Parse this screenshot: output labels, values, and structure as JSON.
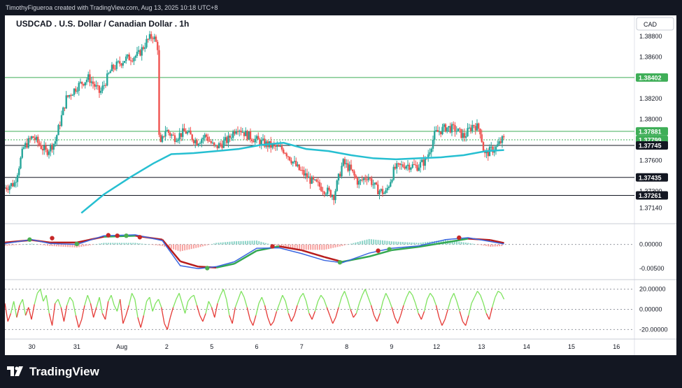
{
  "header": {
    "attribution": "TimothyFigueroa created with TradingView.com, Aug 13, 2025 10:18 UTC+8",
    "brand": "TradingView"
  },
  "colors": {
    "up": "#26a69a",
    "down": "#ef5350",
    "ma_line": "#26bfd1",
    "macd_line": "#3a66e0",
    "signal_line_up": "#34a853",
    "signal_line_down": "#b71c1c",
    "rsi_up": "#7ee35e",
    "rsi_down": "#e53935",
    "level_green": "#3fae58",
    "level_black": "#131722",
    "topbar_bg": "#131722"
  },
  "chart_data": {
    "type": "candlestick",
    "title": "USDCAD . U.S. Dollar / Canadian Dollar . 1h",
    "currency_label": "CAD",
    "price_axis": {
      "range": [
        1.37,
        1.3895
      ],
      "ticks": [
        "1.38800",
        "1.38600",
        "1.38200",
        "1.38000",
        "1.37600",
        "1.37300",
        "1.37140"
      ]
    },
    "price_badges": [
      {
        "label": "1.38402",
        "value": 1.38402,
        "style": "green"
      },
      {
        "label": "1.37881",
        "value": 1.37881,
        "style": "green"
      },
      {
        "label": "1.37799",
        "value": 1.37799,
        "style": "green"
      },
      {
        "label": "1.37745",
        "value": 1.37745,
        "style": "black"
      },
      {
        "label": "1.37435",
        "value": 1.37435,
        "style": "black"
      },
      {
        "label": "1.37261",
        "value": 1.37261,
        "style": "black"
      }
    ],
    "x_axis": {
      "range": [
        0,
        14
      ],
      "labels": [
        {
          "t": 0.6,
          "label": "30"
        },
        {
          "t": 1.6,
          "label": "31"
        },
        {
          "t": 2.6,
          "label": "Aug"
        },
        {
          "t": 3.6,
          "label": "2"
        },
        {
          "t": 4.6,
          "label": "5"
        },
        {
          "t": 5.6,
          "label": "6"
        },
        {
          "t": 6.6,
          "label": "7"
        },
        {
          "t": 7.6,
          "label": "8"
        },
        {
          "t": 8.6,
          "label": "9"
        },
        {
          "t": 9.6,
          "label": "12"
        },
        {
          "t": 10.6,
          "label": "13"
        },
        {
          "t": 11.6,
          "label": "14"
        },
        {
          "t": 12.6,
          "label": "15"
        },
        {
          "t": 13.6,
          "label": "16"
        }
      ]
    },
    "price_path": [
      [
        0.0,
        1.3733
      ],
      [
        0.25,
        1.3738
      ],
      [
        0.45,
        1.3772
      ],
      [
        0.65,
        1.3783
      ],
      [
        0.95,
        1.3768
      ],
      [
        1.15,
        1.3778
      ],
      [
        1.4,
        1.382
      ],
      [
        1.65,
        1.3832
      ],
      [
        1.9,
        1.384
      ],
      [
        2.15,
        1.3825
      ],
      [
        2.4,
        1.3848
      ],
      [
        2.7,
        1.3858
      ],
      [
        3.0,
        1.3862
      ],
      [
        3.2,
        1.3876
      ],
      [
        3.33,
        1.3881
      ],
      [
        3.43,
        1.387
      ],
      [
        3.47,
        1.377
      ],
      [
        3.6,
        1.379
      ],
      [
        3.8,
        1.3782
      ],
      [
        4.05,
        1.3788
      ],
      [
        4.3,
        1.3778
      ],
      [
        4.5,
        1.3784
      ],
      [
        4.7,
        1.3772
      ],
      [
        5.0,
        1.378
      ],
      [
        5.2,
        1.3793
      ],
      [
        5.4,
        1.3785
      ],
      [
        5.7,
        1.3778
      ],
      [
        5.95,
        1.3774
      ],
      [
        6.25,
        1.377
      ],
      [
        6.55,
        1.3752
      ],
      [
        6.85,
        1.374
      ],
      [
        7.1,
        1.3733
      ],
      [
        7.35,
        1.3726
      ],
      [
        7.55,
        1.3758
      ],
      [
        7.7,
        1.3752
      ],
      [
        7.9,
        1.3738
      ],
      [
        8.1,
        1.3745
      ],
      [
        8.3,
        1.3732
      ],
      [
        8.5,
        1.3728
      ],
      [
        8.7,
        1.3752
      ],
      [
        8.95,
        1.3756
      ],
      [
        9.2,
        1.3754
      ],
      [
        9.4,
        1.376
      ],
      [
        9.6,
        1.3786
      ],
      [
        9.85,
        1.3792
      ],
      [
        10.05,
        1.379
      ],
      [
        10.25,
        1.3783
      ],
      [
        10.45,
        1.3795
      ],
      [
        10.6,
        1.379
      ],
      [
        10.7,
        1.3765
      ],
      [
        10.85,
        1.377
      ],
      [
        10.95,
        1.3772
      ],
      [
        11.1,
        1.378
      ]
    ],
    "moving_average_path": [
      [
        1.7,
        1.3709
      ],
      [
        2.2,
        1.3727
      ],
      [
        2.8,
        1.3744
      ],
      [
        3.3,
        1.3757
      ],
      [
        3.7,
        1.3766
      ],
      [
        4.2,
        1.3767
      ],
      [
        4.7,
        1.3769
      ],
      [
        5.2,
        1.3771
      ],
      [
        5.7,
        1.3775
      ],
      [
        6.2,
        1.3777
      ],
      [
        6.7,
        1.3771
      ],
      [
        7.2,
        1.3769
      ],
      [
        7.7,
        1.3765
      ],
      [
        8.2,
        1.3762
      ],
      [
        8.7,
        1.3761
      ],
      [
        9.2,
        1.3762
      ],
      [
        9.7,
        1.3763
      ],
      [
        10.2,
        1.3765
      ],
      [
        10.7,
        1.3769
      ],
      [
        11.1,
        1.377
      ]
    ],
    "macd": {
      "range": [
        -0.007,
        0.004
      ],
      "ticks": [
        "0.00000",
        "-0.00500"
      ],
      "macd_path": [
        [
          0.0,
          0.0002
        ],
        [
          0.6,
          0.001
        ],
        [
          1.0,
          0.0002
        ],
        [
          1.6,
          0.0
        ],
        [
          2.2,
          0.0018
        ],
        [
          2.9,
          0.002
        ],
        [
          3.5,
          0.0008
        ],
        [
          3.9,
          -0.0044
        ],
        [
          4.3,
          -0.005
        ],
        [
          4.7,
          -0.0046
        ],
        [
          5.1,
          -0.0036
        ],
        [
          5.6,
          -0.0008
        ],
        [
          6.1,
          -0.0007
        ],
        [
          6.6,
          -0.0019
        ],
        [
          7.1,
          -0.0033
        ],
        [
          7.5,
          -0.0038
        ],
        [
          8.1,
          -0.0018
        ],
        [
          8.6,
          -0.0008
        ],
        [
          9.2,
          -0.0003
        ],
        [
          9.8,
          0.001
        ],
        [
          10.3,
          0.0014
        ],
        [
          10.8,
          0.0006
        ],
        [
          11.1,
          0.0001
        ]
      ],
      "signal_path": [
        [
          0.0,
          0.0004
        ],
        [
          0.6,
          0.0009
        ],
        [
          1.0,
          0.0004
        ],
        [
          1.6,
          0.0004
        ],
        [
          2.2,
          0.0016
        ],
        [
          2.9,
          0.0018
        ],
        [
          3.5,
          0.001
        ],
        [
          3.9,
          -0.0035
        ],
        [
          4.3,
          -0.0046
        ],
        [
          4.7,
          -0.0048
        ],
        [
          5.1,
          -0.004
        ],
        [
          5.6,
          -0.0013
        ],
        [
          6.1,
          -0.0004
        ],
        [
          6.6,
          -0.0012
        ],
        [
          7.1,
          -0.0026
        ],
        [
          7.5,
          -0.0036
        ],
        [
          8.1,
          -0.0025
        ],
        [
          8.6,
          -0.0012
        ],
        [
          9.2,
          -0.0005
        ],
        [
          9.8,
          0.0004
        ],
        [
          10.3,
          0.0012
        ],
        [
          10.8,
          0.0009
        ],
        [
          11.1,
          0.0003
        ]
      ],
      "cross_markers": [
        {
          "t": 0.55,
          "v": 0.001,
          "kind": "bull"
        },
        {
          "t": 1.05,
          "v": 0.0013,
          "kind": "bear"
        },
        {
          "t": 1.6,
          "v": 0.0001,
          "kind": "bull"
        },
        {
          "t": 2.3,
          "v": 0.0019,
          "kind": "bear"
        },
        {
          "t": 2.5,
          "v": 0.0018,
          "kind": "bear"
        },
        {
          "t": 2.7,
          "v": 0.0018,
          "kind": "bull"
        },
        {
          "t": 3.0,
          "v": 0.0015,
          "kind": "bear"
        },
        {
          "t": 4.5,
          "v": -0.0049,
          "kind": "bull"
        },
        {
          "t": 5.95,
          "v": -0.0004,
          "kind": "bear"
        },
        {
          "t": 7.45,
          "v": -0.0037,
          "kind": "bull"
        },
        {
          "t": 8.3,
          "v": -0.0013,
          "kind": "bear"
        },
        {
          "t": 8.55,
          "v": -0.001,
          "kind": "bull"
        },
        {
          "t": 10.1,
          "v": 0.0014,
          "kind": "bear"
        }
      ]
    },
    "oscillator": {
      "range": [
        -28,
        28
      ],
      "ticks": [
        {
          "v": 20,
          "label": "20.00000"
        },
        {
          "v": 0,
          "label": "0.00000"
        },
        {
          "v": -20,
          "label": "-20.00000"
        }
      ],
      "values": [
        6,
        -12,
        -4,
        8,
        -8,
        4,
        10,
        -6,
        2,
        -10,
        5,
        16,
        20,
        8,
        14,
        -4,
        -16,
        6,
        10,
        2,
        -12,
        4,
        12,
        8,
        -6,
        -18,
        -10,
        4,
        14,
        6,
        -8,
        2,
        12,
        -4,
        -10,
        8,
        14,
        4,
        -2,
        10,
        -14,
        -6,
        4,
        16,
        10,
        -8,
        -18,
        -6,
        8,
        12,
        -2,
        6,
        10,
        2,
        -14,
        -20,
        -8,
        2,
        10,
        16,
        6,
        -4,
        8,
        12,
        14,
        4,
        -6,
        -12,
        -4,
        8,
        2,
        -8,
        6,
        14,
        20,
        10,
        -6,
        -14,
        2,
        10,
        18,
        12,
        2,
        -10,
        -16,
        -6,
        6,
        12,
        4,
        -8,
        -16,
        -12,
        -2,
        6,
        14,
        8,
        -4,
        -12,
        -6,
        4,
        12,
        16,
        8,
        -4,
        -10,
        -2,
        8,
        14,
        10,
        2,
        -6,
        -14,
        -8,
        2,
        12,
        18,
        10,
        0,
        -8,
        -4,
        6,
        14,
        20,
        12,
        4,
        -6,
        -12,
        -4,
        8,
        16,
        10,
        2,
        -8,
        -14,
        -6,
        4,
        12,
        18,
        14,
        6,
        -4,
        -10,
        -2,
        10,
        16,
        12,
        4,
        -8,
        -16,
        -10,
        0,
        10,
        16,
        8,
        -2,
        -12,
        -16,
        -6,
        6,
        12,
        18,
        14,
        6,
        -4,
        -10,
        2,
        12,
        18,
        16,
        10
      ]
    }
  }
}
